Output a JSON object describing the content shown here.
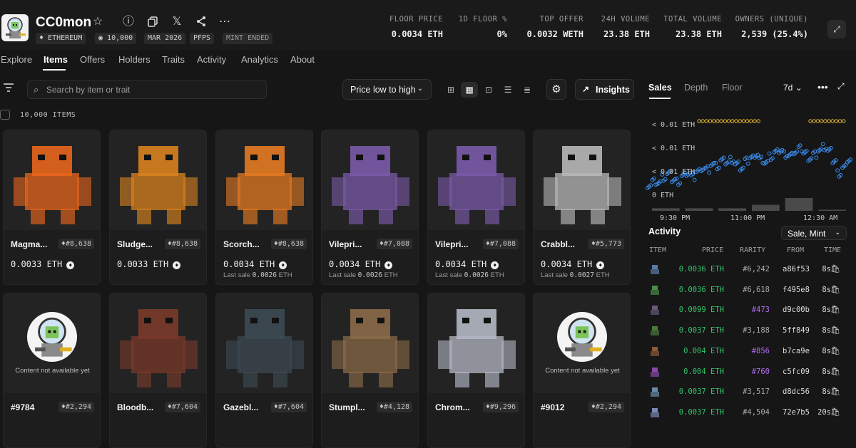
{
  "collection": {
    "title": "CC0mon",
    "pills": [
      "ETHEREUM",
      "10,000",
      "MAR 2026",
      "PFPS",
      "MINT ENDED"
    ]
  },
  "stats": [
    {
      "label": "FLOOR PRICE",
      "value": "0.0034 ETH"
    },
    {
      "label": "1D FLOOR %",
      "value": "0%"
    },
    {
      "label": "TOP OFFER",
      "value": "0.0032 WETH"
    },
    {
      "label": "24H VOLUME",
      "value": "23.38 ETH"
    },
    {
      "label": "TOTAL VOLUME",
      "value": "23.38 ETH"
    },
    {
      "label": "OWNERS (UNIQUE)",
      "value": "2,539 (25.4%)"
    }
  ],
  "tabs": [
    "Explore",
    "Items",
    "Offers",
    "Holders",
    "Traits",
    "Activity",
    "Analytics",
    "About"
  ],
  "search": {
    "placeholder": "Search by item or trait"
  },
  "sort": {
    "label": "Price low to high"
  },
  "insights_label": "Insights",
  "items_count": "10,000 ITEMS",
  "cards_row1": [
    {
      "name": "Magma...",
      "rank": "#8,638",
      "price": "0.0033  ETH",
      "last_sale": "",
      "theme": "#e8661c"
    },
    {
      "name": "Sludge...",
      "rank": "#8,638",
      "price": "0.0033  ETH",
      "last_sale": "",
      "theme": "#d9821f"
    },
    {
      "name": "Scorch...",
      "rank": "#8,638",
      "price": "0.0034  ETH",
      "last_sale": "0.0026",
      "theme": "#e47a22"
    },
    {
      "name": "Vilepri...",
      "rank": "#7,088",
      "price": "0.0034  ETH",
      "last_sale": "0.0026",
      "theme": "#7a5aa8"
    },
    {
      "name": "Vilepri...",
      "rank": "#7,088",
      "price": "0.0034  ETH",
      "last_sale": "0.0026",
      "theme": "#7a5aa8"
    },
    {
      "name": "Crabbl...",
      "rank": "#5,773",
      "price": "0.0034  ETH",
      "last_sale": "0.0027",
      "theme": "#b8b8b8"
    }
  ],
  "cards_row2": [
    {
      "name": "#9784",
      "rank": "#2,294",
      "placeholder": true,
      "placeholder_text": "Content not available yet"
    },
    {
      "name": "Bloodb...",
      "rank": "#7,604",
      "placeholder": false,
      "theme": "#7a3a2a"
    },
    {
      "name": "Gazebl...",
      "rank": "#7,604",
      "placeholder": false,
      "theme": "#3c4a52"
    },
    {
      "name": "Stumpl...",
      "rank": "#4,128",
      "placeholder": false,
      "theme": "#8a6a48"
    },
    {
      "name": "Chrom...",
      "rank": "#9,296",
      "placeholder": false,
      "theme": "#b4b8c4"
    },
    {
      "name": "#9012",
      "rank": "#2,294",
      "placeholder": true,
      "placeholder_text": "Content not available yet"
    }
  ],
  "last_sale_prefix": "Last sale",
  "eth_unit": "ETH",
  "side": {
    "tabs": [
      "Sales",
      "Depth",
      "Floor"
    ],
    "range": "7d"
  },
  "chart_data": {
    "type": "scatter",
    "y_tick_labels": [
      "< 0.01 ETH",
      "< 0.01 ETH",
      "< 0.01 ETH",
      "0 ETH"
    ],
    "x_tick_labels": [
      "9:30 PM",
      "11:00 PM",
      "12:30 AM"
    ],
    "series": [
      {
        "values_normalized": [
          0.25,
          0.3,
          0.28,
          0.35,
          0.4,
          0.32,
          0.3,
          0.38,
          0.42,
          0.36,
          0.45,
          0.5,
          0.48,
          0.55,
          0.52,
          0.6,
          0.58,
          0.62,
          0.55,
          0.5,
          0.6,
          0.65,
          0.7,
          0.62,
          0.58,
          0.66,
          0.72,
          0.75,
          0.7,
          0.68,
          0.74,
          0.78,
          0.72,
          0.65,
          0.7,
          0.76,
          0.8,
          0.74,
          0.6,
          0.42,
          0.5,
          0.62
        ],
        "color": "#3b8ff0"
      }
    ],
    "top_markers_color": "#e8b830",
    "volume_bars": [
      0.12,
      0.12,
      0.12,
      0.28,
      0.6,
      0.05
    ],
    "grid": false
  },
  "activity": {
    "title": "Activity",
    "filter": "Sale, Mint",
    "headers": [
      "ITEM",
      "PRICE",
      "RARITY",
      "FROM",
      "TIME"
    ],
    "rows": [
      {
        "price": "0.0036 ETH",
        "rarity": "#6,242",
        "rare": false,
        "from": "a86f53",
        "time": "8s",
        "color": "#5a7aa8"
      },
      {
        "price": "0.0036 ETH",
        "rarity": "#6,618",
        "rare": false,
        "from": "f495e8",
        "time": "8s",
        "color": "#4a8a4a"
      },
      {
        "price": "0.0099 ETH",
        "rarity": "#473",
        "rare": true,
        "from": "d9c00b",
        "time": "8s",
        "color": "#6a5a7a"
      },
      {
        "price": "0.0037 ETH",
        "rarity": "#3,188",
        "rare": false,
        "from": "5ff849",
        "time": "8s",
        "color": "#4a7a3a"
      },
      {
        "price": "0.004 ETH",
        "rarity": "#856",
        "rare": true,
        "from": "b7ca9e",
        "time": "8s",
        "color": "#8a5a3a"
      },
      {
        "price": "0.004 ETH",
        "rarity": "#760",
        "rare": true,
        "from": "c5fc09",
        "time": "8s",
        "color": "#8a4aa8"
      },
      {
        "price": "0.0037 ETH",
        "rarity": "#3,517",
        "rare": false,
        "from": "d8dc56",
        "time": "8s",
        "color": "#6a8aa8"
      },
      {
        "price": "0.0037 ETH",
        "rarity": "#4,504",
        "rare": false,
        "from": "72e7b5",
        "time": "20s",
        "color": "#7a8ab8"
      }
    ]
  }
}
